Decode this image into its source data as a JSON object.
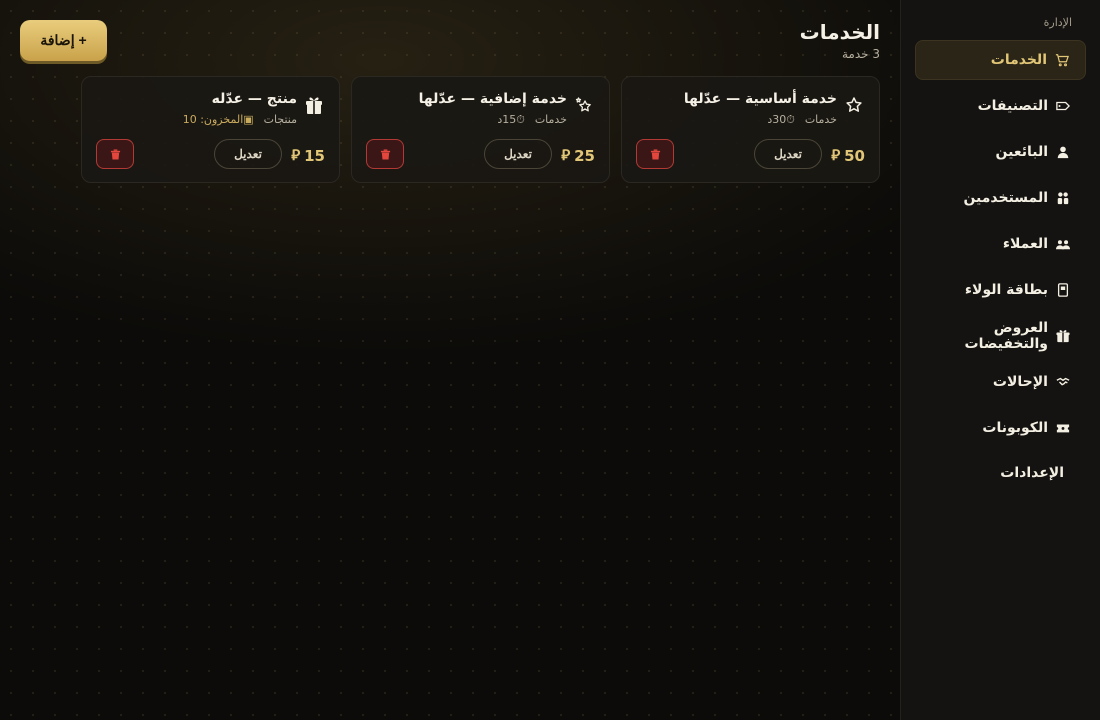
{
  "sidebar": {
    "section_label": "الإدارة",
    "items": [
      {
        "label": "الخدمات",
        "icon": "cart-icon",
        "active": true
      },
      {
        "label": "التصنيفات",
        "icon": "tag-icon",
        "active": false
      },
      {
        "label": "البائعين",
        "icon": "user-icon",
        "active": false
      },
      {
        "label": "المستخدمين",
        "icon": "users-icon",
        "active": false
      },
      {
        "label": "العملاء",
        "icon": "group-icon",
        "active": false
      },
      {
        "label": "بطاقة الولاء",
        "icon": "card-icon",
        "active": false
      },
      {
        "label": "العروض والتخفيضات",
        "icon": "gift-icon",
        "active": false
      },
      {
        "label": "الإحالات",
        "icon": "handshake-icon",
        "active": false
      },
      {
        "label": "الكوبونات",
        "icon": "ticket-icon",
        "active": false
      },
      {
        "label": "الإعدادات",
        "icon": "none",
        "active": false
      }
    ]
  },
  "header": {
    "title": "الخدمات",
    "count": "3 خدمة",
    "add_label": "+ إضافة"
  },
  "cards": [
    {
      "icon": "star-icon",
      "title": "خدمة أساسية — عدّلها",
      "category": "خدمات",
      "detail": "30د",
      "price": "50",
      "edit_label": "تعديل"
    },
    {
      "icon": "sparkle-icon",
      "title": "خدمة إضافية — عدّلها",
      "category": "خدمات",
      "detail": "15د",
      "price": "25",
      "edit_label": "تعديل"
    },
    {
      "icon": "gift-box-icon",
      "title": "منتج — عدّله",
      "category": "منتجات",
      "detail": "المخزون: 10",
      "price": "15",
      "edit_label": "تعديل"
    }
  ],
  "colors": {
    "accent": "#e2c677",
    "danger": "#b33a34",
    "sidebar_bg": "#141311",
    "active_bg": "#2a2516"
  }
}
